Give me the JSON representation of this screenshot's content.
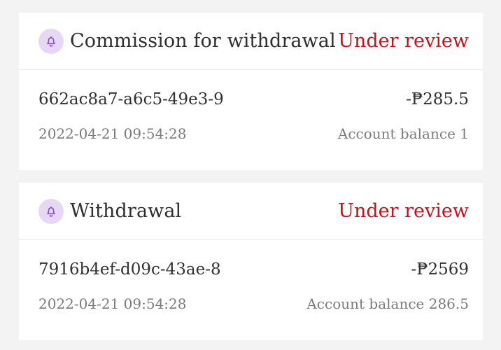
{
  "colors": {
    "status_red": "#c4121a",
    "bell_bg": "#e6d8f5",
    "bell_stroke": "#8b4fd1",
    "page_bg": "#f3f3f3"
  },
  "transactions": [
    {
      "icon": "bell-icon",
      "title": "Commission for withdrawal",
      "status": "Under review",
      "order_id": "662ac8a7-a6c5-49e3-9",
      "amount": "-₱285.5",
      "timestamp": "2022-04-21 09:54:28",
      "balance_label": "Account balance",
      "balance_value": "1"
    },
    {
      "icon": "bell-icon",
      "title": "Withdrawal",
      "status": "Under review",
      "order_id": "7916b4ef-d09c-43ae-8",
      "amount": "-₱2569",
      "timestamp": "2022-04-21 09:54:28",
      "balance_label": "Account balance",
      "balance_value": "286.5"
    }
  ]
}
